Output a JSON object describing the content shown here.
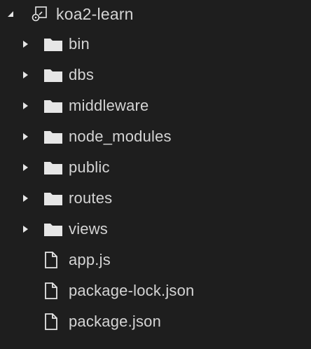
{
  "explorer": {
    "root": {
      "label": "koa2-learn",
      "expanded": true,
      "icon": "repo-root-icon"
    },
    "items": [
      {
        "type": "folder",
        "label": "bin",
        "expanded": false,
        "icon": "folder-icon"
      },
      {
        "type": "folder",
        "label": "dbs",
        "expanded": false,
        "icon": "folder-icon"
      },
      {
        "type": "folder",
        "label": "middleware",
        "expanded": false,
        "icon": "folder-icon"
      },
      {
        "type": "folder",
        "label": "node_modules",
        "expanded": false,
        "icon": "folder-icon"
      },
      {
        "type": "folder",
        "label": "public",
        "expanded": false,
        "icon": "folder-icon"
      },
      {
        "type": "folder",
        "label": "routes",
        "expanded": false,
        "icon": "folder-icon"
      },
      {
        "type": "folder",
        "label": "views",
        "expanded": false,
        "icon": "folder-icon"
      },
      {
        "type": "file",
        "label": "app.js",
        "icon": "file-icon"
      },
      {
        "type": "file",
        "label": "package-lock.json",
        "icon": "file-icon"
      },
      {
        "type": "file",
        "label": "package.json",
        "icon": "file-icon"
      }
    ]
  },
  "colors": {
    "background": "#1e1e1e",
    "text": "#d4d4d4",
    "icon": "#e6e6e6"
  }
}
